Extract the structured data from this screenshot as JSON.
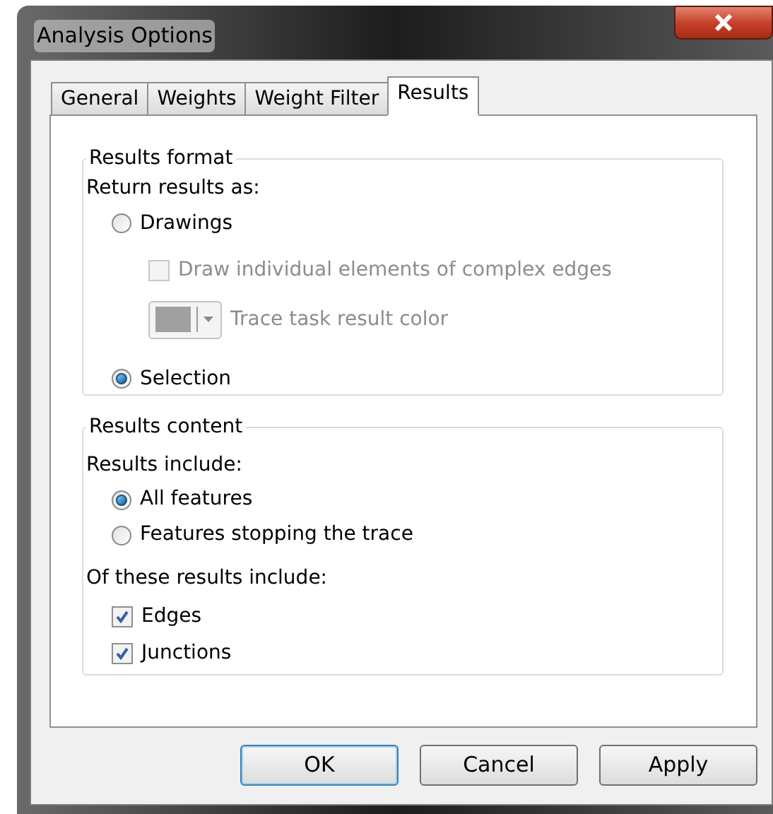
{
  "window": {
    "title": "Analysis Options"
  },
  "tabs": [
    {
      "label": "General",
      "selected": false
    },
    {
      "label": "Weights",
      "selected": false
    },
    {
      "label": "Weight Filter",
      "selected": false
    },
    {
      "label": "Results",
      "selected": true
    }
  ],
  "results_format": {
    "title": "Results format",
    "prompt": "Return results as:",
    "options": [
      {
        "kind": "radio",
        "label": "Drawings",
        "selected": false,
        "children": [
          {
            "kind": "checkbox",
            "label": "Draw individual elements of complex edges",
            "checked": false,
            "disabled": true
          },
          {
            "kind": "color",
            "label": "Trace task result color",
            "color": "#a0a0a0",
            "disabled": true
          }
        ]
      },
      {
        "kind": "radio",
        "label": "Selection",
        "selected": true
      }
    ]
  },
  "results_content": {
    "title": "Results content",
    "include_prompt": "Results include:",
    "include_options": [
      {
        "label": "All features",
        "selected": true
      },
      {
        "label": "Features stopping the trace",
        "selected": false
      }
    ],
    "of_these_prompt": "Of these results include:",
    "of_these_options": [
      {
        "label": "Edges",
        "checked": true
      },
      {
        "label": "Junctions",
        "checked": true
      }
    ]
  },
  "buttons": [
    {
      "label": "OK",
      "default": true
    },
    {
      "label": "Cancel",
      "default": false
    },
    {
      "label": "Apply",
      "default": false
    }
  ]
}
